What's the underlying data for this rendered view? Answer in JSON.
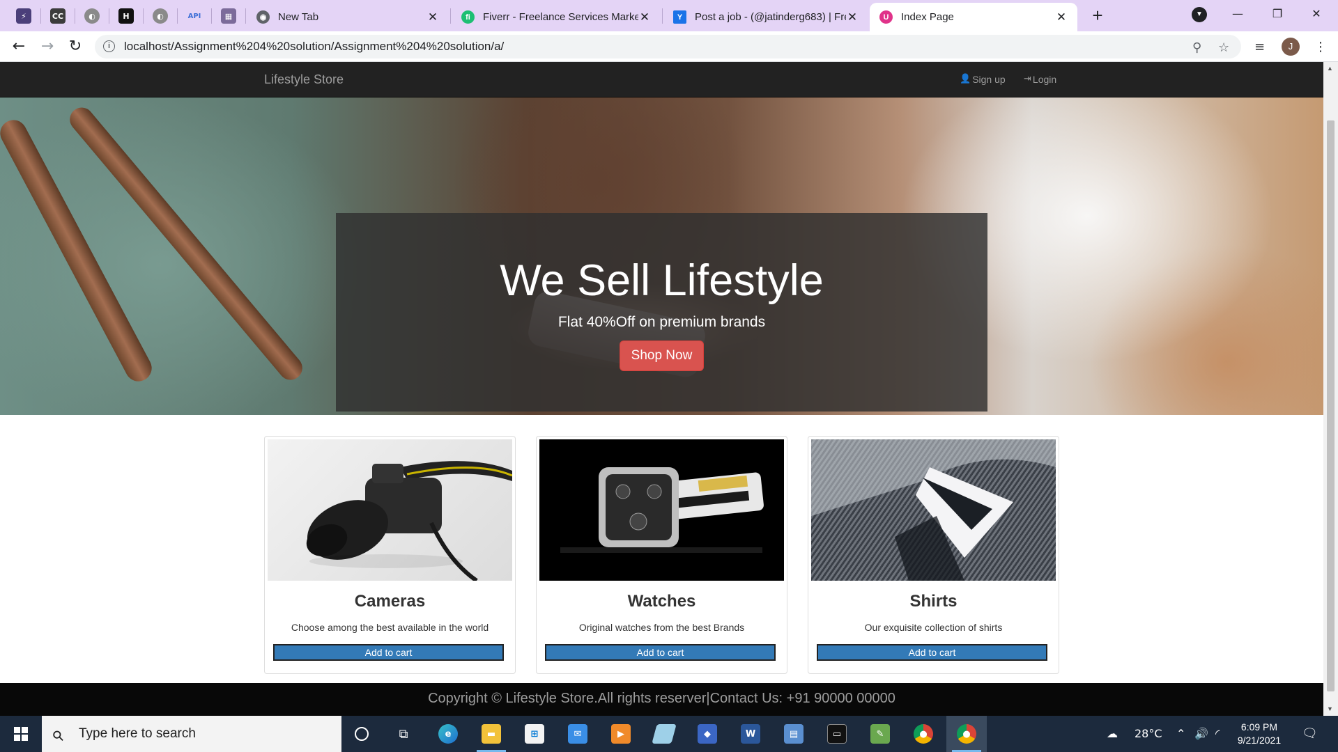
{
  "browser": {
    "pinned_tabs": [
      {
        "name": "pinned-tab-1",
        "glyph": "⚡",
        "color": "#4b3f7a"
      },
      {
        "name": "pinned-tab-2",
        "glyph": "CC",
        "color": "#3c3c3c"
      },
      {
        "name": "pinned-tab-3",
        "glyph": "◐",
        "color": "#8a8a8a"
      },
      {
        "name": "pinned-tab-4",
        "glyph": "H",
        "color": "#111111"
      },
      {
        "name": "pinned-tab-5",
        "glyph": "◐",
        "color": "#8a8a8a"
      },
      {
        "name": "pinned-tab-6",
        "glyph": "API",
        "color": "#6d8fd6"
      },
      {
        "name": "pinned-tab-7",
        "glyph": "▦",
        "color": "#7c6b9a"
      }
    ],
    "tabs": [
      {
        "title": "New Tab",
        "favicon_color": "#5f6368",
        "favicon_glyph": "◉"
      },
      {
        "title": "Fiverr - Freelance Services Marke",
        "favicon_color": "#1dbf73",
        "favicon_glyph": "fi"
      },
      {
        "title": "Post a job - (@jatinderg683) | Fre",
        "favicon_color": "#1a73e8",
        "favicon_glyph": "Y"
      },
      {
        "title": "Index Page",
        "favicon_color": "#e0338a",
        "favicon_glyph": "U"
      }
    ],
    "url": "localhost/Assignment%204%20solution/Assignment%204%20solution/a/"
  },
  "site": {
    "brand": "Lifestyle Store",
    "nav": {
      "signup": "Sign up",
      "login": "Login"
    },
    "banner": {
      "heading": "We Sell Lifestyle",
      "subheading": "Flat 40%Off on premium brands",
      "button": "Shop Now"
    },
    "products": [
      {
        "title": "Cameras",
        "description": "Choose among the best available in the world",
        "button": "Add to cart"
      },
      {
        "title": "Watches",
        "description": "Original watches from the best Brands",
        "button": "Add to cart"
      },
      {
        "title": "Shirts",
        "description": "Our exquisite collection of shirts",
        "button": "Add to cart"
      }
    ],
    "footer": "Copyright © Lifestyle Store.All rights reserver|Contact Us: +91 90000 00000"
  },
  "taskbar": {
    "search_placeholder": "Type here to search",
    "weather": "28°C",
    "time": "6:09 PM",
    "date": "9/21/2021"
  },
  "colors": {
    "navbar": "#222222",
    "shop_button": "#d9534f",
    "cart_button": "#337ab7",
    "footer": "#080808",
    "tab_strip": "#e4d4f6"
  }
}
